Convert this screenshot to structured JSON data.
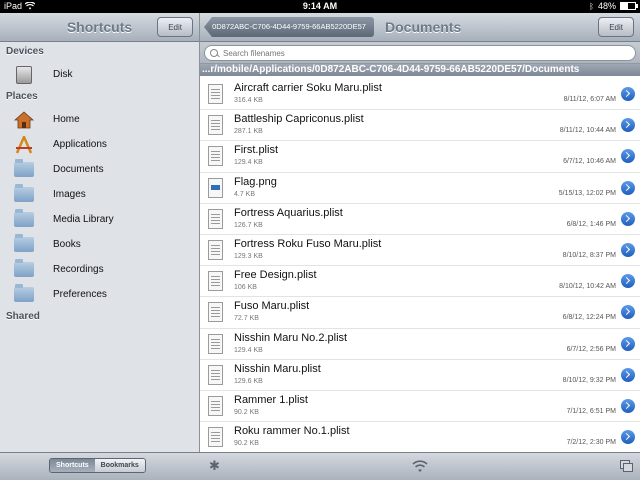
{
  "status_bar": {
    "device": "iPad",
    "time": "9:14 AM",
    "battery": "48%",
    "battery_level": 0.48
  },
  "shortcuts": {
    "title": "Shortcuts",
    "edit_label": "Edit",
    "sections": {
      "devices": "Devices",
      "places": "Places",
      "shared": "Shared"
    },
    "devices": [
      {
        "label": "Disk",
        "icon": "disk-icon"
      }
    ],
    "places": [
      {
        "label": "Home",
        "icon": "home-icon"
      },
      {
        "label": "Applications",
        "icon": "applications-icon"
      },
      {
        "label": "Documents",
        "icon": "folder-icon"
      },
      {
        "label": "Images",
        "icon": "images-folder-icon"
      },
      {
        "label": "Media Library",
        "icon": "media-folder-icon"
      },
      {
        "label": "Books",
        "icon": "folder-icon"
      },
      {
        "label": "Recordings",
        "icon": "folder-icon"
      },
      {
        "label": "Preferences",
        "icon": "folder-icon"
      }
    ],
    "tabs": {
      "active": "Shortcuts",
      "inactive": "Bookmarks"
    }
  },
  "documents": {
    "back_label": "0D872ABC-C706-4D44-9759-66AB5220DE57",
    "title": "Documents",
    "edit_label": "Edit",
    "search_placeholder": "Search filenames",
    "path": "...r/mobile/Applications/0D872ABC-C706-4D44-9759-66AB5220DE57/Documents",
    "files": [
      {
        "name": "Aircraft carrier Soku Maru.plist",
        "size": "316.4 KB",
        "date": "8/11/12, 6:07 AM",
        "type": "plist"
      },
      {
        "name": "Battleship Capriconus.plist",
        "size": "287.1 KB",
        "date": "8/11/12, 10:44 AM",
        "type": "plist"
      },
      {
        "name": "First.plist",
        "size": "129.4 KB",
        "date": "6/7/12, 10:46 AM",
        "type": "plist"
      },
      {
        "name": "Flag.png",
        "size": "4.7 KB",
        "date": "5/15/13, 12:02 PM",
        "type": "png"
      },
      {
        "name": "Fortress Aquarius.plist",
        "size": "126.7 KB",
        "date": "6/8/12, 1:46 PM",
        "type": "plist"
      },
      {
        "name": "Fortress Roku Fuso Maru.plist",
        "size": "129.3 KB",
        "date": "8/10/12, 8:37 PM",
        "type": "plist"
      },
      {
        "name": "Free Design.plist",
        "size": "106 KB",
        "date": "8/10/12, 10:42 AM",
        "type": "plist"
      },
      {
        "name": "Fuso Maru.plist",
        "size": "72.7 KB",
        "date": "6/8/12, 12:24 PM",
        "type": "plist"
      },
      {
        "name": "Nisshin Maru No.2.plist",
        "size": "129.4 KB",
        "date": "6/7/12, 2:56 PM",
        "type": "plist"
      },
      {
        "name": "Nisshin Maru.plist",
        "size": "129.6 KB",
        "date": "8/10/12, 9:32 PM",
        "type": "plist"
      },
      {
        "name": "Rammer 1.plist",
        "size": "90.2 KB",
        "date": "7/1/12, 6:51 PM",
        "type": "plist"
      },
      {
        "name": "Roku rammer No.1.plist",
        "size": "90.2 KB",
        "date": "7/2/12, 2:30 PM",
        "type": "plist"
      }
    ]
  },
  "colors": {
    "accent_blue": "#2f6fd0",
    "toolbar_gray": "#a7b0bb",
    "sidebar_bg": "#dfe2e7"
  }
}
